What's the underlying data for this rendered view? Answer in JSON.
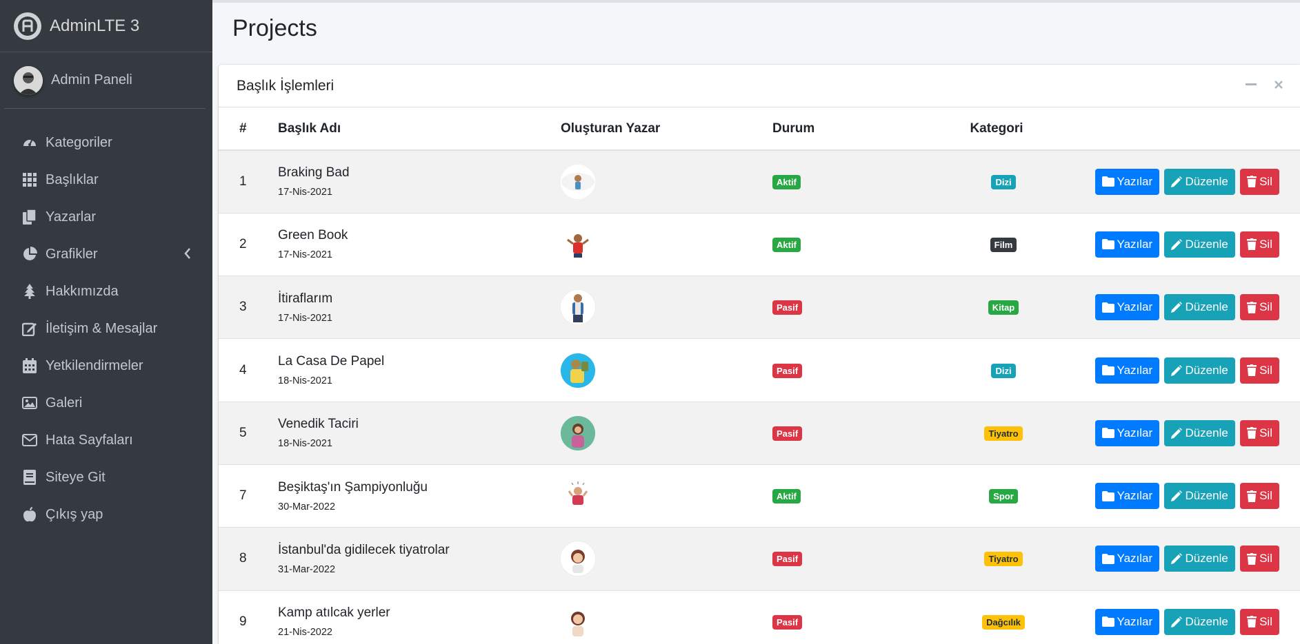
{
  "brand": {
    "name": "AdminLTE 3"
  },
  "user": {
    "name": "Admin Paneli"
  },
  "sidebar": {
    "items": [
      {
        "label": "Kategoriler",
        "icon": "tachometer-icon"
      },
      {
        "label": "Başlıklar",
        "icon": "grid-icon"
      },
      {
        "label": "Yazarlar",
        "icon": "copy-icon"
      },
      {
        "label": "Grafikler",
        "icon": "pie-chart-icon",
        "has_chevron": true
      },
      {
        "label": "Hakkımızda",
        "icon": "tree-icon"
      },
      {
        "label": "İletişim & Mesajlar",
        "icon": "edit-icon"
      },
      {
        "label": "Yetkilendirmeler",
        "icon": "calendar-icon"
      },
      {
        "label": "Galeri",
        "icon": "image-icon"
      },
      {
        "label": "Hata Sayfaları",
        "icon": "envelope-icon"
      },
      {
        "label": "Siteye Git",
        "icon": "book-icon"
      },
      {
        "label": "Çıkış yap",
        "icon": "apple-icon"
      }
    ]
  },
  "page": {
    "title": "Projects"
  },
  "card": {
    "title": "Başlık İşlemleri"
  },
  "table": {
    "headers": {
      "num": "#",
      "title": "Başlık Adı",
      "author": "Oluşturan Yazar",
      "status": "Durum",
      "category": "Kategori"
    },
    "buttons": {
      "posts": "Yazılar",
      "edit": "Düzenle",
      "delete": "Sil"
    },
    "rows": [
      {
        "num": "1",
        "title": "Braking Bad",
        "date": "17-Nis-2021",
        "status": "Aktif",
        "category": "Dizi"
      },
      {
        "num": "2",
        "title": "Green Book",
        "date": "17-Nis-2021",
        "status": "Aktif",
        "category": "Film"
      },
      {
        "num": "3",
        "title": "İtiraflarım",
        "date": "17-Nis-2021",
        "status": "Pasif",
        "category": "Kitap"
      },
      {
        "num": "4",
        "title": "La Casa De Papel",
        "date": "18-Nis-2021",
        "status": "Pasif",
        "category": "Dizi"
      },
      {
        "num": "5",
        "title": "Venedik Taciri",
        "date": "18-Nis-2021",
        "status": "Pasif",
        "category": "Tiyatro"
      },
      {
        "num": "7",
        "title": "Beşiktaş'ın Şampiyonluğu",
        "date": "30-Mar-2022",
        "status": "Aktif",
        "category": "Spor"
      },
      {
        "num": "8",
        "title": "İstanbul'da gidilecek tiyatrolar",
        "date": "31-Mar-2022",
        "status": "Pasif",
        "category": "Tiyatro"
      },
      {
        "num": "9",
        "title": "Kamp atılcak yerler",
        "date": "21-Nis-2022",
        "status": "Pasif",
        "category": "Dağcılık"
      }
    ]
  },
  "colors": {
    "sidebar_bg": "#343a40",
    "primary": "#007bff",
    "info": "#17a2b8",
    "danger": "#dc3545",
    "success": "#28a745",
    "warning": "#ffc107",
    "dark": "#343a40",
    "category_colors": {
      "Dizi": "#17a2b8",
      "Film": "#343a40",
      "Kitap": "#28a745",
      "Tiyatro": "#ffc107",
      "Spor": "#28a745",
      "Dağcılık": "#ffc107"
    },
    "status_colors": {
      "Aktif": "#28a745",
      "Pasif": "#dc3545"
    }
  }
}
